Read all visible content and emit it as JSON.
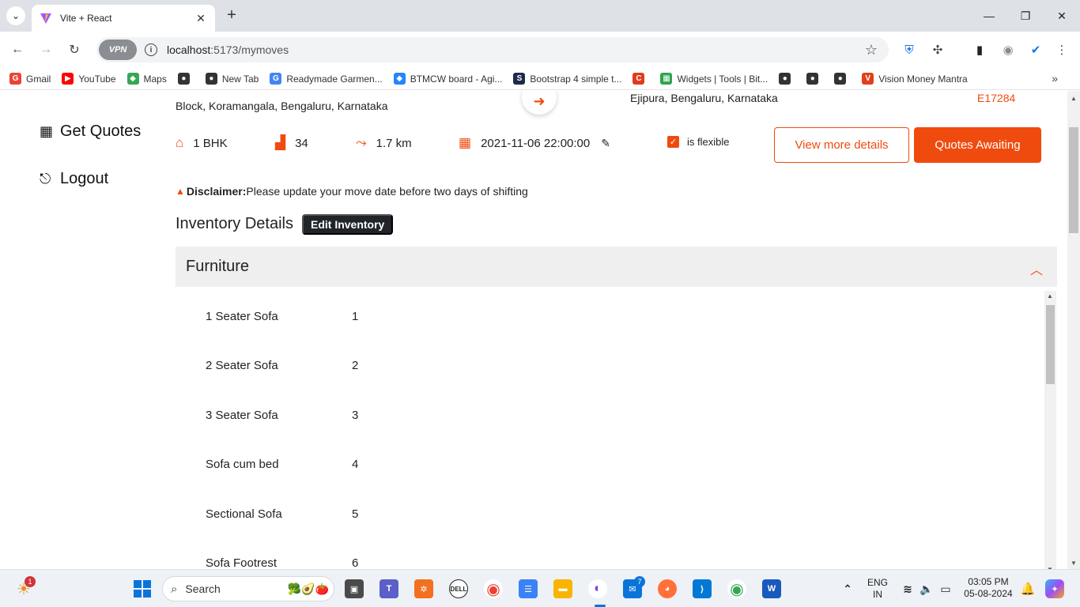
{
  "browser": {
    "tab_title": "Vite + React",
    "url_host": "localhost",
    "url_path": ":5173/mymoves",
    "vpn_label": "VPN",
    "bookmarks": [
      {
        "label": "Gmail",
        "color": "#ea4335",
        "glyph": "G"
      },
      {
        "label": "YouTube",
        "color": "#ff0000",
        "glyph": "▶"
      },
      {
        "label": "Maps",
        "color": "#34a853",
        "glyph": "◆"
      },
      {
        "label": "",
        "color": "#333333",
        "glyph": "●"
      },
      {
        "label": "New Tab",
        "color": "#333333",
        "glyph": "●"
      },
      {
        "label": "Readymade Garmen...",
        "color": "#4285f4",
        "glyph": "G"
      },
      {
        "label": "BTMCW board - Agi...",
        "color": "#2684ff",
        "glyph": "◆"
      },
      {
        "label": "Bootstrap 4 simple t...",
        "color": "#1e2a4a",
        "glyph": "S"
      },
      {
        "label": "",
        "color": "#e23a1e",
        "glyph": "C"
      },
      {
        "label": "Widgets | Tools | Bit...",
        "color": "#2ea44f",
        "glyph": "▦"
      },
      {
        "label": "",
        "color": "#333333",
        "glyph": "●"
      },
      {
        "label": "",
        "color": "#333333",
        "glyph": "●"
      },
      {
        "label": "",
        "color": "#333333",
        "glyph": "●"
      },
      {
        "label": "Vision Money Mantra",
        "color": "#e0401c",
        "glyph": "V"
      }
    ]
  },
  "sidebar": {
    "get_quotes": "Get Quotes",
    "logout": "Logout"
  },
  "move": {
    "from_address": "Block, Koramangala, Bengaluru, Karnataka",
    "to_address": "Ejipura, Bengaluru, Karnataka",
    "order_id": "E17284",
    "house_type": "1 BHK",
    "items_count": "34",
    "distance": "1.7 km",
    "move_date": "2021-11-06 22:00:00",
    "flexible_label": "is flexible",
    "is_flexible": true,
    "view_details_label": "View more details",
    "quotes_label": "Quotes Awaiting",
    "disclaimer_title": "Disclaimer:",
    "disclaimer_text": "Please update your move date before two days of shifting"
  },
  "inventory": {
    "title": "Inventory Details",
    "edit_label": "Edit Inventory",
    "category": "Furniture",
    "items": [
      {
        "name": "1 Seater Sofa",
        "qty": "1"
      },
      {
        "name": "2 Seater Sofa",
        "qty": "2"
      },
      {
        "name": "3 Seater Sofa",
        "qty": "3"
      },
      {
        "name": "Sofa cum bed",
        "qty": "4"
      },
      {
        "name": "Sectional Sofa",
        "qty": "5"
      },
      {
        "name": "Sofa Footrest",
        "qty": "6"
      }
    ]
  },
  "taskbar": {
    "search_label": "Search",
    "lang_top": "ENG",
    "lang_bottom": "IN",
    "time": "03:05 PM",
    "date": "05-08-2024",
    "weather_badge": "1",
    "mail_badge": "7"
  },
  "colors": {
    "accent": "#f04b0f"
  }
}
